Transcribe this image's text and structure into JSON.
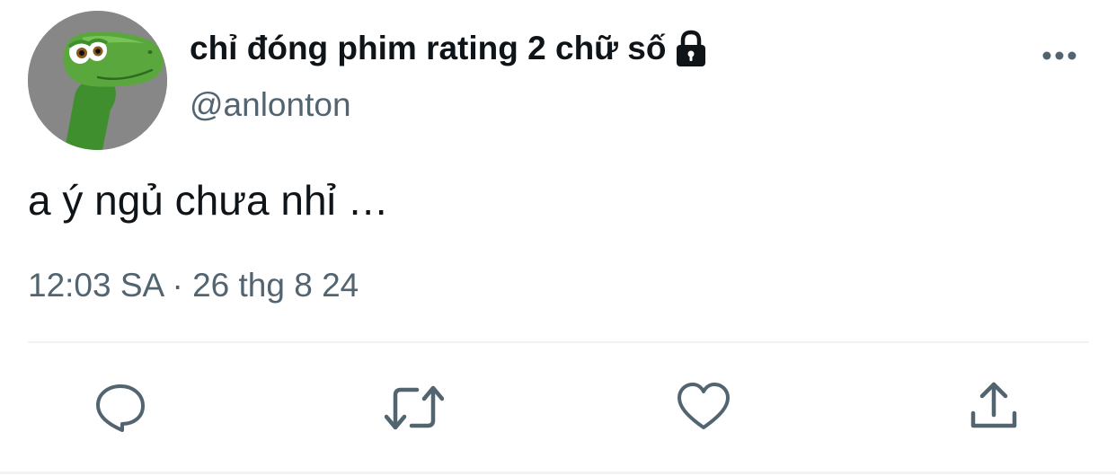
{
  "tweet": {
    "display_name": "chỉ đóng phim rating 2 chữ số",
    "handle": "@anlonton",
    "text": "a ý ngủ chưa nhỉ …",
    "timestamp": "12:03 SA · 26 thg 8 24",
    "is_protected": true
  },
  "icons": {
    "avatar": "green-dinosaur-avatar",
    "protected": "lock-icon",
    "more": "more-dots-icon",
    "actions": [
      "reply-icon",
      "retweet-icon",
      "like-icon",
      "share-icon"
    ]
  },
  "colors": {
    "primary_text": "#0f1419",
    "secondary_text": "#536471",
    "icon": "#536471",
    "divider": "#eff3f4"
  }
}
